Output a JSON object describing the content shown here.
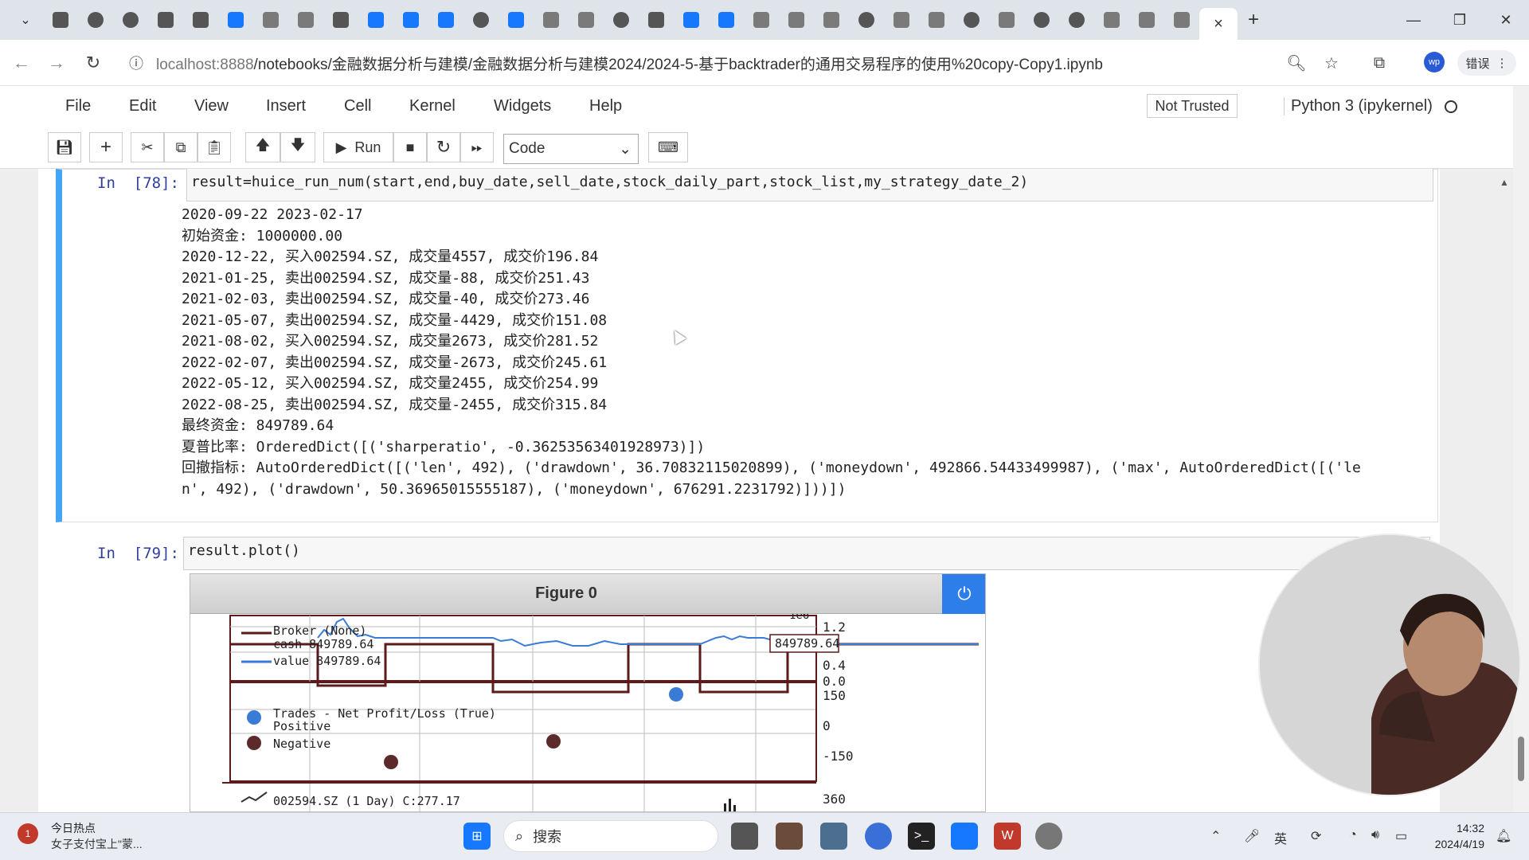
{
  "browser": {
    "tab_icons": [
      "calendar-icon",
      "github-icon",
      "github-icon",
      "bilibili-icon",
      "bilibili-icon",
      "zhihu-icon",
      "app-icon",
      "app-icon",
      "bilibili-icon",
      "zhihu-icon",
      "zhihu-icon",
      "zhihu-icon",
      "github-icon",
      "zhihu-icon",
      "app-icon",
      "app-icon",
      "github-icon",
      "bilibili-icon",
      "cloud-icon",
      "cloud-icon",
      "book-icon",
      "book-icon",
      "book-icon",
      "person-icon",
      "app-icon",
      "app-icon",
      "github-icon",
      "app-icon",
      "github-icon",
      "loading-icon",
      "app-icon",
      "app-icon",
      "app-icon"
    ],
    "active_tab_close": "×",
    "new_tab": "+",
    "url_host": "localhost:8888",
    "url_path": "/notebooks/金融数据分析与建模/金融数据分析与建模2024/2024-5-基于backtrader的通用交易程序的使用%20copy-Copy1.ipynb",
    "error_button": "错误",
    "profile": "wp"
  },
  "jupyter": {
    "menu": [
      "File",
      "Edit",
      "View",
      "Insert",
      "Cell",
      "Kernel",
      "Widgets",
      "Help"
    ],
    "trust": "Not Trusted",
    "kernel": "Python 3 (ipykernel)",
    "toolbar": {
      "run": "Run",
      "cell_type": "Code"
    }
  },
  "cell78": {
    "prompt": "In  [78]:",
    "code": "result=huice_run_num(start,end,buy_date,sell_date,stock_daily_part,stock_list,my_strategy_date_2)",
    "output": [
      "2020-09-22 2023-02-17",
      "初始资金: 1000000.00",
      "2020-12-22, 买入002594.SZ, 成交量4557, 成交价196.84",
      "2021-01-25, 卖出002594.SZ, 成交量-88, 成交价251.43",
      "2021-02-03, 卖出002594.SZ, 成交量-40, 成交价273.46",
      "2021-05-07, 卖出002594.SZ, 成交量-4429, 成交价151.08",
      "2021-08-02, 买入002594.SZ, 成交量2673, 成交价281.52",
      "2022-02-07, 卖出002594.SZ, 成交量-2673, 成交价245.61",
      "2022-05-12, 买入002594.SZ, 成交量2455, 成交价254.99",
      "2022-08-25, 卖出002594.SZ, 成交量-2455, 成交价315.84",
      "最终资金: 849789.64",
      "夏普比率: OrderedDict([('sharperatio', -0.36253563401928973)])",
      "回撤指标: AutoOrderedDict([('len', 492), ('drawdown', 36.70832115020899), ('moneydown', 492866.54433499987), ('max', AutoOrderedDict([('le",
      "n', 492), ('drawdown', 50.36965015555187), ('moneydown', 676291.2231792)]))])"
    ]
  },
  "cell79": {
    "prompt": "In  [79]:",
    "code": "result.plot()"
  },
  "figure": {
    "title": "Figure 0",
    "broker_legend": [
      "Broker (None)",
      "cash 849789.64",
      "value 849789.64"
    ],
    "broker_value_tag": "849789.64",
    "broker_ticks": [
      "1.2",
      "0.4",
      "0.0"
    ],
    "corner_label": "1e6",
    "trades_legend": [
      "Trades - Net Profit/Loss (True)",
      "Positive",
      "Negative"
    ],
    "trades_ticks": [
      "150",
      "0",
      "-150"
    ],
    "price_legend": "002594.SZ (1 Day) C:277.17",
    "price_tick": "360",
    "colors": {
      "cash": "#5c1a1a",
      "value": "#3a7bd5",
      "positive": "#3a7bd5",
      "negative": "#5c2a2a"
    }
  },
  "taskbar": {
    "news_title": "今日热点",
    "news_sub": "女子支付宝上\"蒙...",
    "search_placeholder": "搜索",
    "time": "14:32",
    "date": "2024/4/19"
  }
}
